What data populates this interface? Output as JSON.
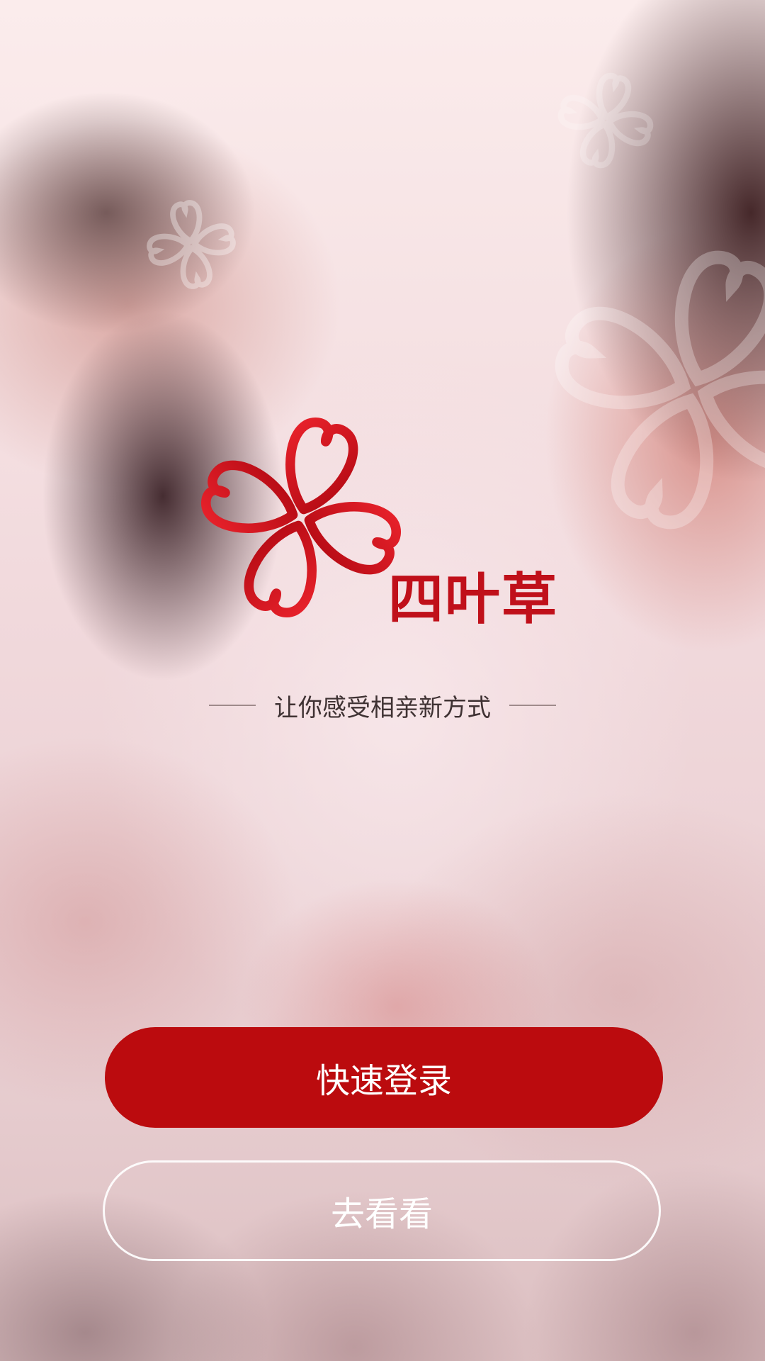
{
  "brand": {
    "name": "四叶草",
    "tagline": "让你感受相亲新方式",
    "logo_icon": "four-leaf-clover-logo",
    "color": "#c0101a"
  },
  "actions": {
    "quick_login_label": "快速登录",
    "browse_label": "去看看"
  },
  "colors": {
    "primary_button": "#bb0b0e",
    "secondary_button_border": "#ffffff"
  }
}
